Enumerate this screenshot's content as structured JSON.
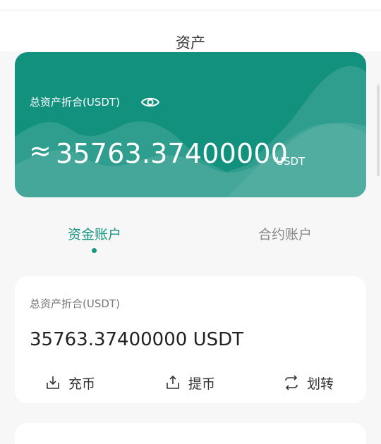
{
  "header": {
    "title": "资产"
  },
  "summary": {
    "label": "总资产折合(USDT)",
    "approx_symbol": "≈",
    "amount": "35763.37400000",
    "unit": "USDT",
    "background_color": "#13917f"
  },
  "tabs": [
    {
      "label": "资金账户",
      "active": true
    },
    {
      "label": "合约账户",
      "active": false
    }
  ],
  "account_panel": {
    "label": "总资产折合(USDT)",
    "amount": "35763.37400000 USDT",
    "actions": [
      {
        "label": "充币",
        "icon": "deposit-icon"
      },
      {
        "label": "提币",
        "icon": "withdraw-icon"
      },
      {
        "label": "划转",
        "icon": "transfer-icon"
      }
    ]
  },
  "colors": {
    "accent": "#17957f",
    "card": "#13917f"
  }
}
